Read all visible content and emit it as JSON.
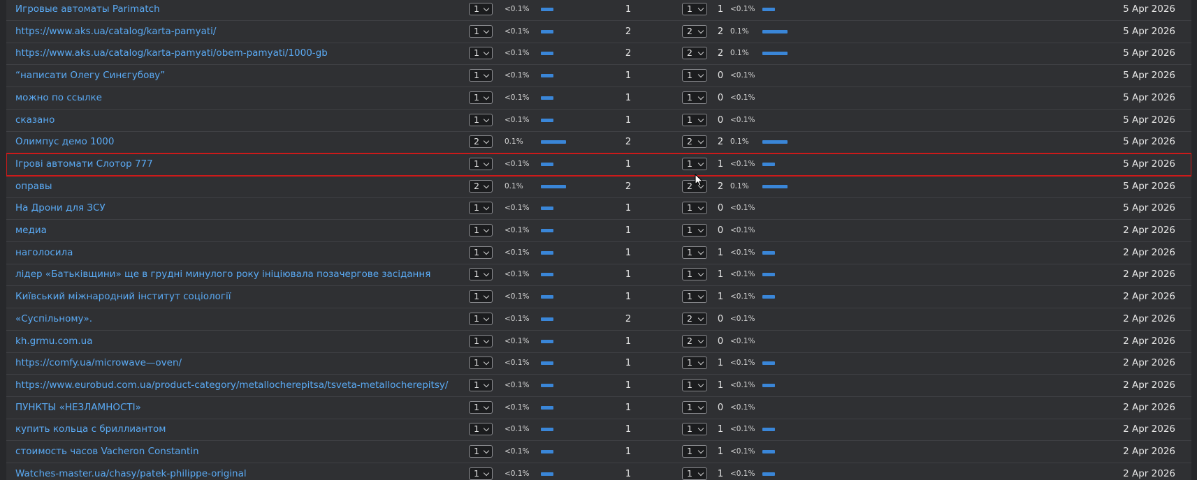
{
  "rows": [
    {
      "keyword": "Игровые автоматы Parimatch",
      "pos": "1",
      "share": "<0.1%",
      "share_level": 0.4,
      "traffic": "1",
      "prev_pos": "1",
      "prev_traffic": "1",
      "prev_share": "<0.1%",
      "prev_share_level": 0.4,
      "date": "5 Apr 2026"
    },
    {
      "keyword": "https://www.aks.ua/catalog/karta-pamyati/",
      "pos": "1",
      "share": "<0.1%",
      "share_level": 0.4,
      "traffic": "2",
      "prev_pos": "2",
      "prev_traffic": "2",
      "prev_share": "0.1%",
      "prev_share_level": 0.8,
      "date": "5 Apr 2026"
    },
    {
      "keyword": "https://www.aks.ua/catalog/karta-pamyati/obem-pamyati/1000-gb",
      "pos": "1",
      "share": "<0.1%",
      "share_level": 0.4,
      "traffic": "2",
      "prev_pos": "2",
      "prev_traffic": "2",
      "prev_share": "0.1%",
      "prev_share_level": 0.8,
      "date": "5 Apr 2026"
    },
    {
      "keyword": "“написати Олегу Синєгубову”",
      "pos": "1",
      "share": "<0.1%",
      "share_level": 0.4,
      "traffic": "1",
      "prev_pos": "1",
      "prev_traffic": "0",
      "prev_share": "<0.1%",
      "prev_share_level": 0,
      "date": "5 Apr 2026"
    },
    {
      "keyword": "можно по ссылке",
      "pos": "1",
      "share": "<0.1%",
      "share_level": 0.4,
      "traffic": "1",
      "prev_pos": "1",
      "prev_traffic": "0",
      "prev_share": "<0.1%",
      "prev_share_level": 0,
      "date": "5 Apr 2026"
    },
    {
      "keyword": "сказано",
      "pos": "1",
      "share": "<0.1%",
      "share_level": 0.4,
      "traffic": "1",
      "prev_pos": "1",
      "prev_traffic": "0",
      "prev_share": "<0.1%",
      "prev_share_level": 0,
      "date": "5 Apr 2026"
    },
    {
      "keyword": "Олимпус демо 1000",
      "pos": "2",
      "share": "0.1%",
      "share_level": 0.8,
      "traffic": "2",
      "prev_pos": "2",
      "prev_traffic": "2",
      "prev_share": "0.1%",
      "prev_share_level": 0.8,
      "date": "5 Apr 2026"
    },
    {
      "keyword": "Ігрові автомати Слотор 777",
      "pos": "1",
      "share": "<0.1%",
      "share_level": 0.4,
      "traffic": "1",
      "prev_pos": "1",
      "prev_traffic": "1",
      "prev_share": "<0.1%",
      "prev_share_level": 0.4,
      "date": "5 Apr 2026",
      "highlighted": true
    },
    {
      "keyword": "оправы",
      "pos": "2",
      "share": "0.1%",
      "share_level": 0.8,
      "traffic": "2",
      "prev_pos": "2",
      "prev_traffic": "2",
      "prev_share": "0.1%",
      "prev_share_level": 0.8,
      "date": "5 Apr 2026"
    },
    {
      "keyword": "На Дрони для ЗСУ",
      "pos": "1",
      "share": "<0.1%",
      "share_level": 0.4,
      "traffic": "1",
      "prev_pos": "1",
      "prev_traffic": "0",
      "prev_share": "<0.1%",
      "prev_share_level": 0,
      "date": "5 Apr 2026"
    },
    {
      "keyword": "медиа",
      "pos": "1",
      "share": "<0.1%",
      "share_level": 0.4,
      "traffic": "1",
      "prev_pos": "1",
      "prev_traffic": "0",
      "prev_share": "<0.1%",
      "prev_share_level": 0,
      "date": "2 Apr 2026"
    },
    {
      "keyword": "наголосила",
      "pos": "1",
      "share": "<0.1%",
      "share_level": 0.4,
      "traffic": "1",
      "prev_pos": "1",
      "prev_traffic": "1",
      "prev_share": "<0.1%",
      "prev_share_level": 0.4,
      "date": "2 Apr 2026"
    },
    {
      "keyword": "лідер «Батьківщини» ще в грудні минулого року ініціювала позачергове засідання",
      "pos": "1",
      "share": "<0.1%",
      "share_level": 0.4,
      "traffic": "1",
      "prev_pos": "1",
      "prev_traffic": "1",
      "prev_share": "<0.1%",
      "prev_share_level": 0.4,
      "date": "2 Apr 2026"
    },
    {
      "keyword": "Київський міжнародний інститут соціології",
      "pos": "1",
      "share": "<0.1%",
      "share_level": 0.4,
      "traffic": "1",
      "prev_pos": "1",
      "prev_traffic": "1",
      "prev_share": "<0.1%",
      "prev_share_level": 0.4,
      "date": "2 Apr 2026"
    },
    {
      "keyword": "«Суспільному».",
      "pos": "1",
      "share": "<0.1%",
      "share_level": 0.4,
      "traffic": "2",
      "prev_pos": "2",
      "prev_traffic": "0",
      "prev_share": "<0.1%",
      "prev_share_level": 0,
      "date": "2 Apr 2026"
    },
    {
      "keyword": "kh.grmu.com.ua",
      "pos": "1",
      "share": "<0.1%",
      "share_level": 0.4,
      "traffic": "1",
      "prev_pos": "2",
      "prev_traffic": "0",
      "prev_share": "<0.1%",
      "prev_share_level": 0,
      "date": "2 Apr 2026"
    },
    {
      "keyword": "https://comfy.ua/microwave—oven/",
      "pos": "1",
      "share": "<0.1%",
      "share_level": 0.4,
      "traffic": "1",
      "prev_pos": "1",
      "prev_traffic": "1",
      "prev_share": "<0.1%",
      "prev_share_level": 0.4,
      "date": "2 Apr 2026"
    },
    {
      "keyword": "https://www.eurobud.com.ua/product-category/metallocherepitsa/tsveta-metallocherepitsy/",
      "pos": "1",
      "share": "<0.1%",
      "share_level": 0.4,
      "traffic": "1",
      "prev_pos": "1",
      "prev_traffic": "1",
      "prev_share": "<0.1%",
      "prev_share_level": 0.4,
      "date": "2 Apr 2026"
    },
    {
      "keyword": "ПУНКТЫ «НЕЗЛАМНОСТІ»",
      "pos": "1",
      "share": "<0.1%",
      "share_level": 0.4,
      "traffic": "1",
      "prev_pos": "1",
      "prev_traffic": "0",
      "prev_share": "<0.1%",
      "prev_share_level": 0,
      "date": "2 Apr 2026"
    },
    {
      "keyword": "купить кольца с бриллиантом",
      "pos": "1",
      "share": "<0.1%",
      "share_level": 0.4,
      "traffic": "1",
      "prev_pos": "1",
      "prev_traffic": "1",
      "prev_share": "<0.1%",
      "prev_share_level": 0.4,
      "date": "2 Apr 2026"
    },
    {
      "keyword": "стоимость часов Vacheron Constantin",
      "pos": "1",
      "share": "<0.1%",
      "share_level": 0.4,
      "traffic": "1",
      "prev_pos": "1",
      "prev_traffic": "1",
      "prev_share": "<0.1%",
      "prev_share_level": 0.4,
      "date": "2 Apr 2026"
    },
    {
      "keyword": "Watches-master.ua/chasy/patek-philippe-original",
      "pos": "1",
      "share": "<0.1%",
      "share_level": 0.4,
      "traffic": "1",
      "prev_pos": "1",
      "prev_traffic": "1",
      "prev_share": "<0.1%",
      "prev_share_level": 0.4,
      "date": "2 Apr 2026"
    }
  ],
  "colors": {
    "link": "#5aaaf4",
    "bar": "#3a86d8",
    "highlight": "#cc1a1a",
    "row_bg": "#2f3033"
  },
  "icons": {
    "dropdown": "chevron-down-icon",
    "pointer": "mouse-cursor-icon"
  }
}
